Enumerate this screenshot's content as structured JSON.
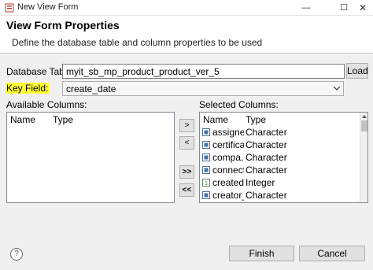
{
  "window": {
    "title": "New View Form",
    "minimize_glyph": "—",
    "maximize_glyph": "☐",
    "close_glyph": "✕"
  },
  "header": {
    "title": "View Form Properties",
    "description": "Define the database table and column properties to be used"
  },
  "database_table": {
    "label": "Database Table:",
    "value": "myit_sb_mp_product_product_ver_5",
    "load_button": "Load"
  },
  "key_field": {
    "label": "Key Field:",
    "value": "create_date",
    "highlight_color": "#ffff33"
  },
  "available_columns": {
    "label": "Available Columns:",
    "col_name": "Name",
    "col_type": "Type",
    "rows": []
  },
  "move_buttons": {
    "add": ">",
    "remove": "<",
    "add_all": ">>",
    "remove_all": "<<"
  },
  "selected_columns": {
    "label": "Selected Columns:",
    "col_name": "Name",
    "col_type": "Type",
    "rows": [
      {
        "name": "assigne...",
        "type": "Character",
        "icon": "field-icon"
      },
      {
        "name": "certifica...",
        "type": "Character",
        "icon": "field-icon"
      },
      {
        "name": "compa...",
        "type": "Character",
        "icon": "field-icon"
      },
      {
        "name": "connect...",
        "type": "Character",
        "icon": "field-icon"
      },
      {
        "name": "created...",
        "type": "Integer",
        "icon": "numeric-field-icon"
      },
      {
        "name": "creator_...",
        "type": "Character",
        "icon": "field-icon"
      }
    ]
  },
  "footer": {
    "help_glyph": "?",
    "finish_button": "Finish",
    "cancel_button": "Cancel"
  }
}
